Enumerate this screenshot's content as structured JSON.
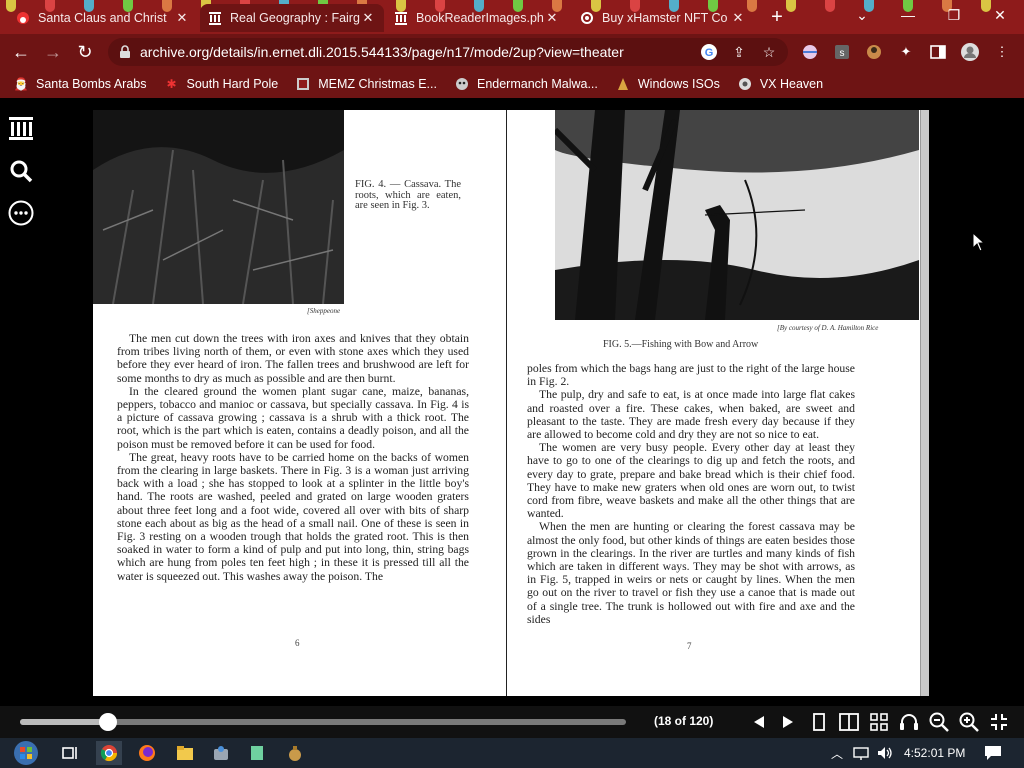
{
  "browser": {
    "tabs": [
      {
        "title": "Santa Claus and Christ",
        "icon": "santa-favicon-icon",
        "active": false
      },
      {
        "title": "Real Geography : Fairg",
        "icon": "archive-favicon-icon",
        "active": true
      },
      {
        "title": "BookReaderImages.ph",
        "icon": "archive-favicon-icon",
        "active": false
      },
      {
        "title": "Buy xHamster NFT Co",
        "icon": "gear-favicon-icon",
        "active": false
      }
    ],
    "url": "archive.org/details/in.ernet.dli.2015.544133/page/n17/mode/2up?view=theater",
    "theme_color": "#8e1b1b",
    "bookmarks": [
      {
        "label": "Santa Bombs Arabs",
        "icon": "santa-icon"
      },
      {
        "label": "South Hard Pole",
        "icon": "snowflake-icon"
      },
      {
        "label": "MEMZ Christmas E...",
        "icon": "memz-icon"
      },
      {
        "label": "Endermanch Malwa...",
        "icon": "endermanch-icon"
      },
      {
        "label": "Windows ISOs",
        "icon": "windows-iso-icon"
      },
      {
        "label": "VX Heaven",
        "icon": "vx-heaven-icon"
      }
    ]
  },
  "book": {
    "left": {
      "caption": "FIG. 4. — Cassava. The roots, which are eaten, are seen in Fig. 3.",
      "credit": "[Sheppeone",
      "paragraphs": [
        "The men cut down the trees with iron axes and knives that they obtain from tribes living north of them, or even with stone axes which they used before they ever heard of iron. The fallen trees and brushwood are left for some months to dry as much as possible and are then burnt.",
        "In the cleared ground the women plant sugar cane, maize, bananas, peppers, tobacco and manioc or cassava, but specially cassava. In Fig. 4 is a picture of cassava growing ; cassava is a shrub with a thick root. The root, which is the part which is eaten, contains a deadly poison, and all the poison must be removed before it can be used for food.",
        "The great, heavy roots have to be carried home on the backs of women from the clearing in large baskets. There in Fig. 3 is a woman just arriving back with a load ; she has stopped to look at a splinter in the little boy's hand. The roots are washed, peeled and grated on large wooden graters about three feet long and a foot wide, covered all over with bits of sharp stone each about as big as the head of a small nail. One of these is seen in Fig. 3 resting on a wooden trough that holds the grated root. This is then soaked in water to form a kind of pulp and put into long, thin, string bags which are hung from poles ten feet high ; in these it is pressed till all the water is squeezed out. This washes away the poison. The"
      ],
      "page_number": "6"
    },
    "right": {
      "credit": "[By courtesy of D. A. Hamilton Rice",
      "caption": "FIG. 5.—Fishing with Bow and Arrow",
      "paragraphs": [
        "poles from which the bags hang are just to the right of the large house in Fig. 2.",
        "The pulp, dry and safe to eat, is at once made into large flat cakes and roasted over a fire. These cakes, when baked, are sweet and pleasant to the taste. They are made fresh every day because if they are allowed to become cold and dry they are not so nice to eat.",
        "The women are very busy people. Every other day at least they have to go to one of the clearings to dig up and fetch the roots, and every day to grate, prepare and bake bread which is their chief food. They have to make new graters when old ones are worn out, to twist cord from fibre, weave baskets and make all the other things that are wanted.",
        "When the men are hunting or clearing the forest cassava may be almost the only food, but other kinds of things are eaten besides those grown in the clearings. In the river are turtles and many kinds of fish which are taken in different ways. They may be shot with arrows, as in Fig. 5, trapped in weirs or nets or caught by lines. When the men go out on the river to travel or fish they use a canoe that is made out of a single tree. The trunk is hollowed out with fire and axe and the sides"
      ],
      "page_number": "7"
    }
  },
  "reader": {
    "page_count": "(18 of 120)",
    "progress": 0.145,
    "controls": [
      "prev-page-icon",
      "next-page-icon",
      "one-page-view-icon",
      "two-page-view-icon",
      "thumbnail-view-icon",
      "read-aloud-icon",
      "zoom-out-icon",
      "zoom-in-icon",
      "fullscreen-icon"
    ]
  },
  "taskbar": {
    "time": "4:52:01 PM"
  }
}
